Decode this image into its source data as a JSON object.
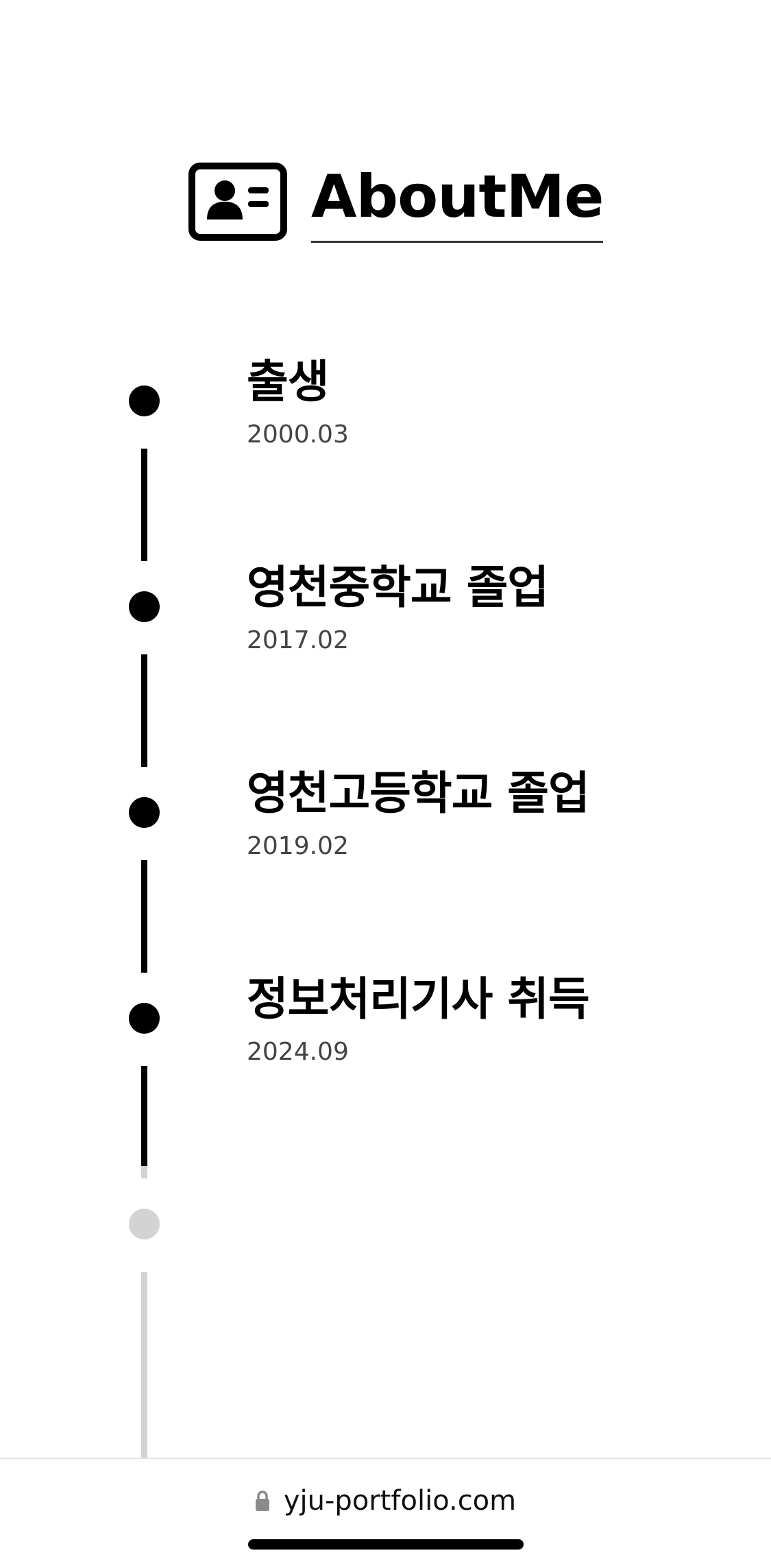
{
  "header": {
    "icon": "id-card-icon",
    "title": "AboutMe"
  },
  "timeline": {
    "items": [
      {
        "title": "출생",
        "date": "2000.03"
      },
      {
        "title": "영천중학교 졸업",
        "date": "2017.02"
      },
      {
        "title": "영천고등학교 졸업",
        "date": "2019.02"
      },
      {
        "title": "정보처리기사 취득",
        "date": "2024.09"
      }
    ],
    "active_color": "#000000",
    "inactive_color": "#d3d3d3"
  },
  "address_bar": {
    "icon": "lock-icon",
    "url": "yju-portfolio.com"
  }
}
